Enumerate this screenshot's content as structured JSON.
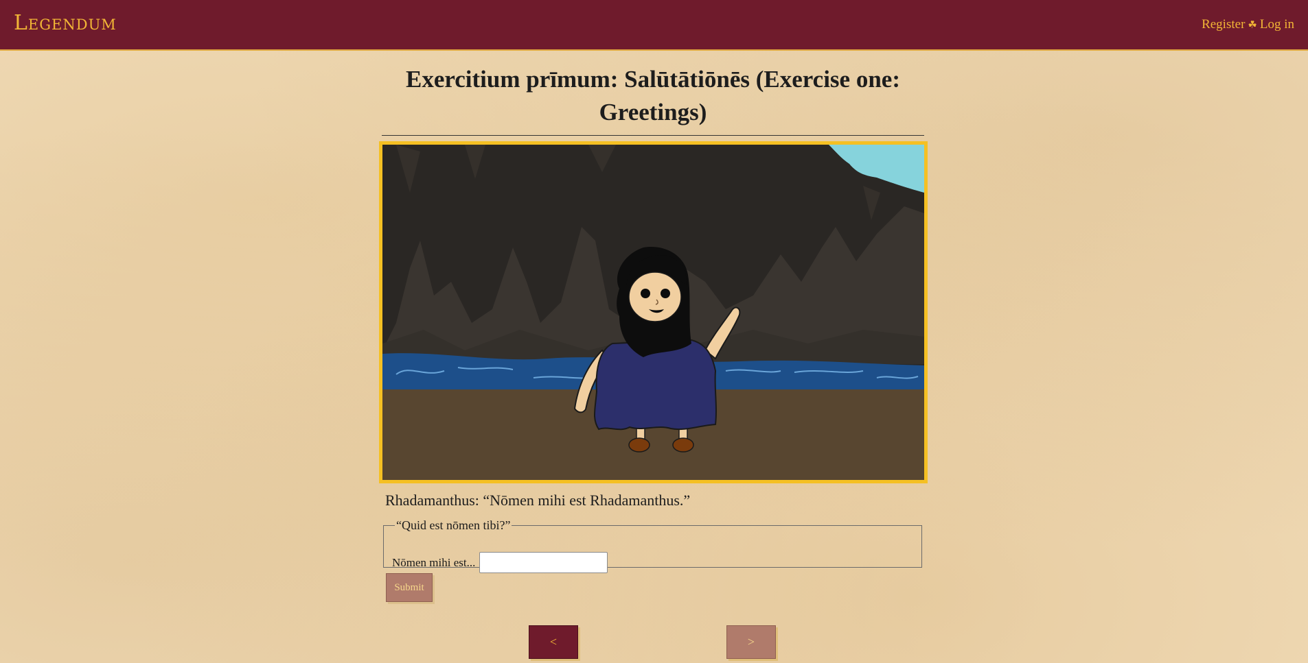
{
  "header": {
    "logo_text": "Legendum",
    "register_label": "Register",
    "separator": "☘",
    "login_label": "Log in"
  },
  "page": {
    "title": "Exercitium prīmum: Salūtātiōnēs (Exercise one: Greetings)"
  },
  "scene": {
    "description_icon": "cave-scene-illustration"
  },
  "dialogue": {
    "line": "Rhadamanthus: “Nōmen mihi est Rhadamanthus.”"
  },
  "question": {
    "legend": "“Quid est nōmen tibi?”",
    "prompt": "Nōmen mihi est...",
    "answer_value": "",
    "answer_placeholder": ""
  },
  "actions": {
    "submit_label": "Submit",
    "prev_label": "<",
    "next_label": ">"
  },
  "colors": {
    "header_bg": "#6f1b2c",
    "accent_gold": "#f2b636",
    "frame_border": "#f5c023",
    "page_bg": "#f3dfbd",
    "disabled_button": "#b07b6b"
  }
}
